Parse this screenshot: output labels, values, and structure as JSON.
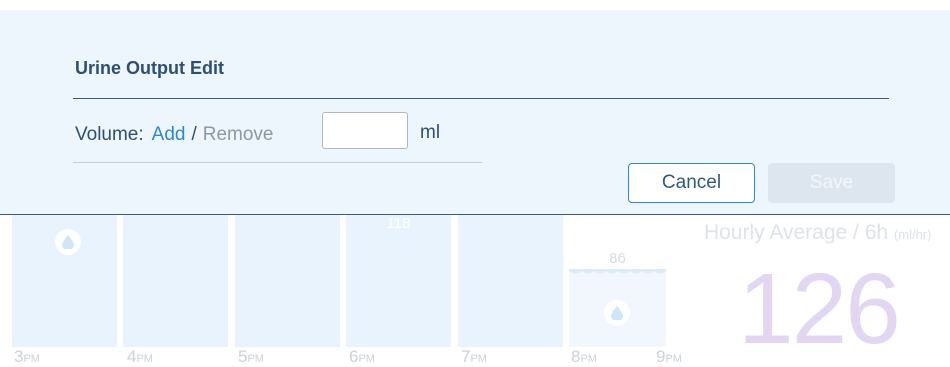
{
  "dialog": {
    "title": "Urine Output Edit",
    "volume_label": "Volume:",
    "add_label": "Add",
    "separator": "/",
    "remove_label": "Remove",
    "volume_value": "",
    "unit": "ml",
    "cancel_label": "Cancel",
    "save_label": "Save"
  },
  "background": {
    "hours": [
      {
        "num": "3",
        "suffix": "PM"
      },
      {
        "num": "4",
        "suffix": "PM"
      },
      {
        "num": "5",
        "suffix": "PM"
      },
      {
        "num": "6",
        "suffix": "PM"
      },
      {
        "num": "7",
        "suffix": "PM"
      },
      {
        "num": "8",
        "suffix": "PM"
      },
      {
        "num": "9",
        "suffix": "PM"
      }
    ],
    "bar_value_6pm": "118",
    "bar_value_8pm": "86",
    "hourly_average_title": "Hourly Average / 6h",
    "hourly_average_unit": "(ml/hr)",
    "hourly_average_value": "126",
    "colors": {
      "bar": "#e9f3fd",
      "accent_blue": "#2b88d8",
      "title_navy": "#2d4f73",
      "average_value": "#e3d6f2"
    },
    "icons": [
      "water-drop-icon"
    ]
  }
}
